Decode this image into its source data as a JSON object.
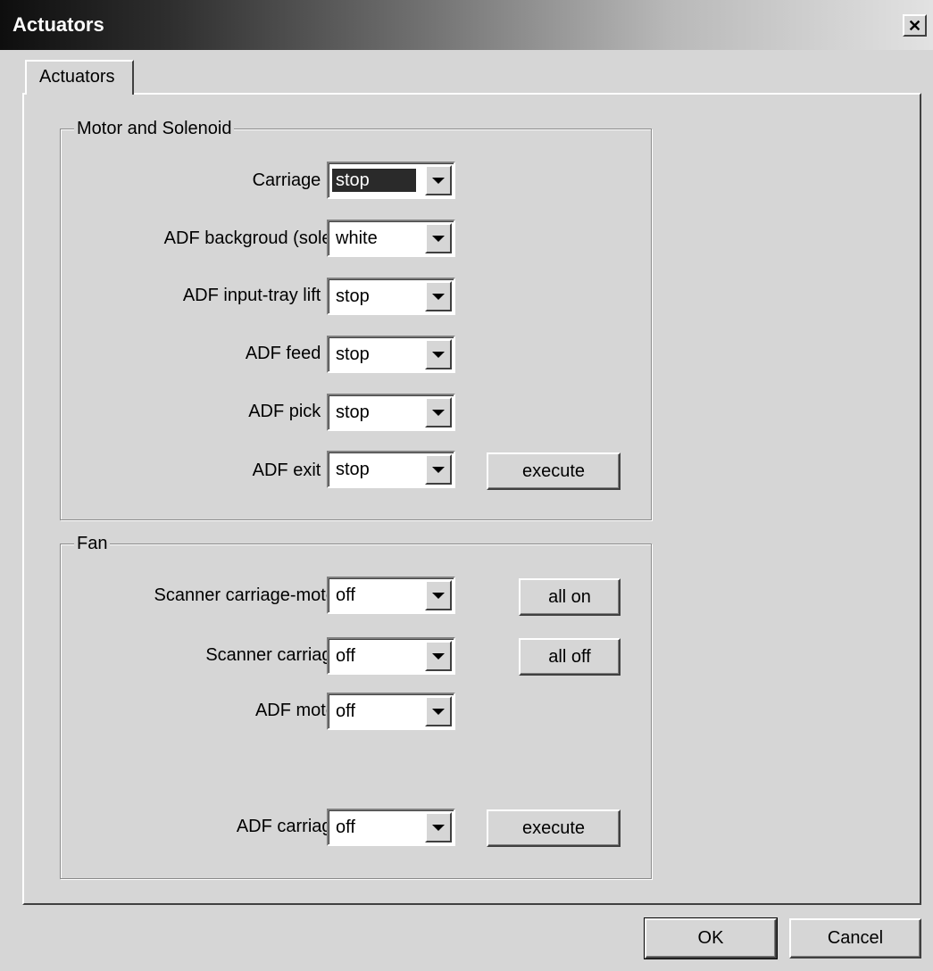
{
  "window": {
    "title": "Actuators",
    "close_symbol": "✕"
  },
  "tabs": [
    {
      "label": "Actuators",
      "active": true
    }
  ],
  "motor_group": {
    "legend": "Motor and Solenoid",
    "rows": [
      {
        "label": "Carriage motor",
        "value": "stop",
        "selected": true
      },
      {
        "label": "ADF backgroud (solenoid)",
        "value": "white"
      },
      {
        "label": "ADF input-tray lift motor",
        "value": "stop"
      },
      {
        "label": "ADF feed motor",
        "value": "stop"
      },
      {
        "label": "ADF pick motor",
        "value": "stop"
      },
      {
        "label": "ADF exit motor",
        "value": "stop"
      }
    ],
    "execute_label": "execute"
  },
  "fan_group": {
    "legend": "Fan",
    "rows": [
      {
        "label": "Scanner carriage-motor fan",
        "value": "off"
      },
      {
        "label": "Scanner carriage fan",
        "value": "off"
      },
      {
        "label": "ADF motor fan",
        "value": "off"
      },
      {
        "label": "ADF carriage fan",
        "value": "off"
      }
    ],
    "all_on_label": "all on",
    "all_off_label": "all off",
    "execute_label": "execute"
  },
  "footer": {
    "ok_label": "OK",
    "cancel_label": "Cancel"
  }
}
